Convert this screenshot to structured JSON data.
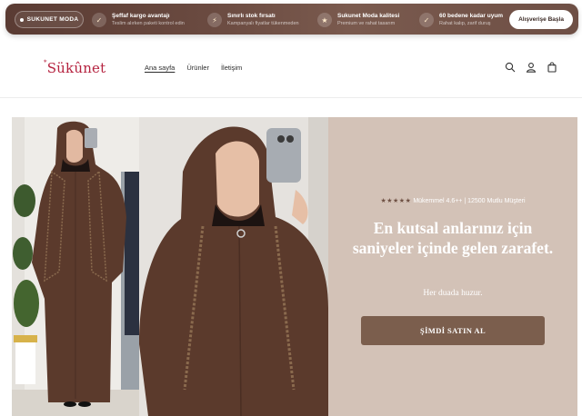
{
  "announcement": {
    "brand_label": "SUKUNET MODA",
    "features": [
      {
        "icon": "check-icon",
        "title": "Şeffaf kargo avantajı",
        "subtitle": "Teslim alırken paketi kontrol edin"
      },
      {
        "icon": "lightning-icon",
        "title": "Sınırlı stok fırsatı",
        "subtitle": "Kampanyalı fiyatlar tükenmeden"
      },
      {
        "icon": "star-icon",
        "title": "Sukunet Moda kalitesi",
        "subtitle": "Premium ve rahat tasarım"
      },
      {
        "icon": "check-icon",
        "title": "60 bedene kadar uyum",
        "subtitle": "Rahat kalıp, zarif duruş"
      }
    ],
    "cta_label": "Alışverişe Başla"
  },
  "header": {
    "logo_text": "Sükûnet",
    "nav": [
      {
        "label": "Ana sayfa",
        "active": true
      },
      {
        "label": "Ürünler",
        "active": false
      },
      {
        "label": "İletişim",
        "active": false
      }
    ],
    "icons": [
      "search-icon",
      "account-icon",
      "cart-icon"
    ]
  },
  "hero": {
    "rating_stars": "★★★★★",
    "rating_text": "Mükemmel 4.6++ | 12500 Mutlu Müşteri",
    "headline": "En kutsal anlarınız için saniyeler içinde gelen zarafet.",
    "subline": "Her duada huzur.",
    "cta_label": "ŞİMDİ SATIN AL"
  },
  "colors": {
    "accent": "#b5223f",
    "topbar": "#6a4a40",
    "panel": "#d3c2b7",
    "button": "#7b5e4d",
    "garment": "#5b3a2c"
  }
}
